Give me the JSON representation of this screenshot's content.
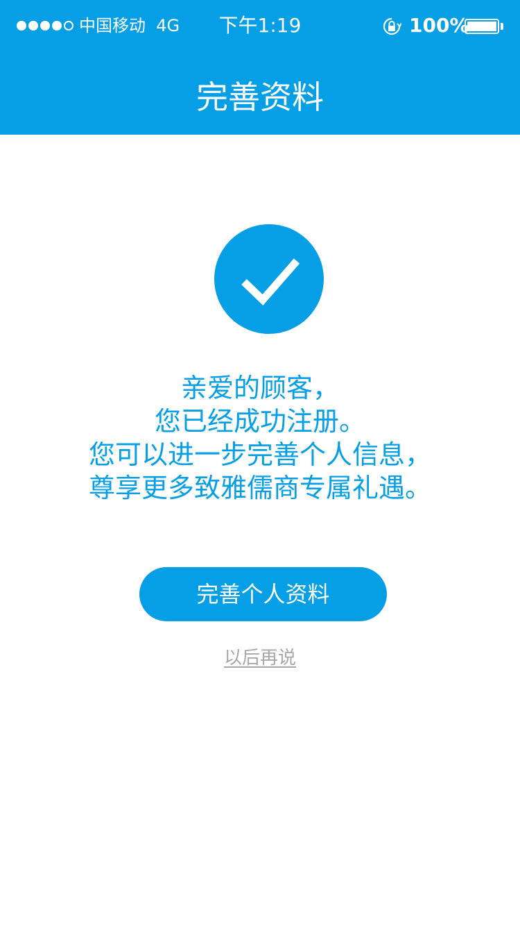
{
  "status_bar": {
    "carrier": "中国移动",
    "network": "4G",
    "time": "下午1:19",
    "battery_percent": "100%",
    "signal_strength": 4,
    "signal_max": 5,
    "icons": [
      "signal-icon",
      "rotation-lock-icon",
      "battery-icon"
    ]
  },
  "nav": {
    "title": "完善资料"
  },
  "success": {
    "icon": "checkmark-icon",
    "lines": [
      "亲爱的顾客，",
      "您已经成功注册。",
      "您可以进一步完善个人信息，",
      "尊享更多致雅儒商专属礼遇。"
    ]
  },
  "actions": {
    "primary_label": "完善个人资料",
    "secondary_label": "以后再说"
  },
  "colors": {
    "brand": "#069fe6",
    "background": "#ffffff",
    "link_gray": "#a8a8a8"
  }
}
